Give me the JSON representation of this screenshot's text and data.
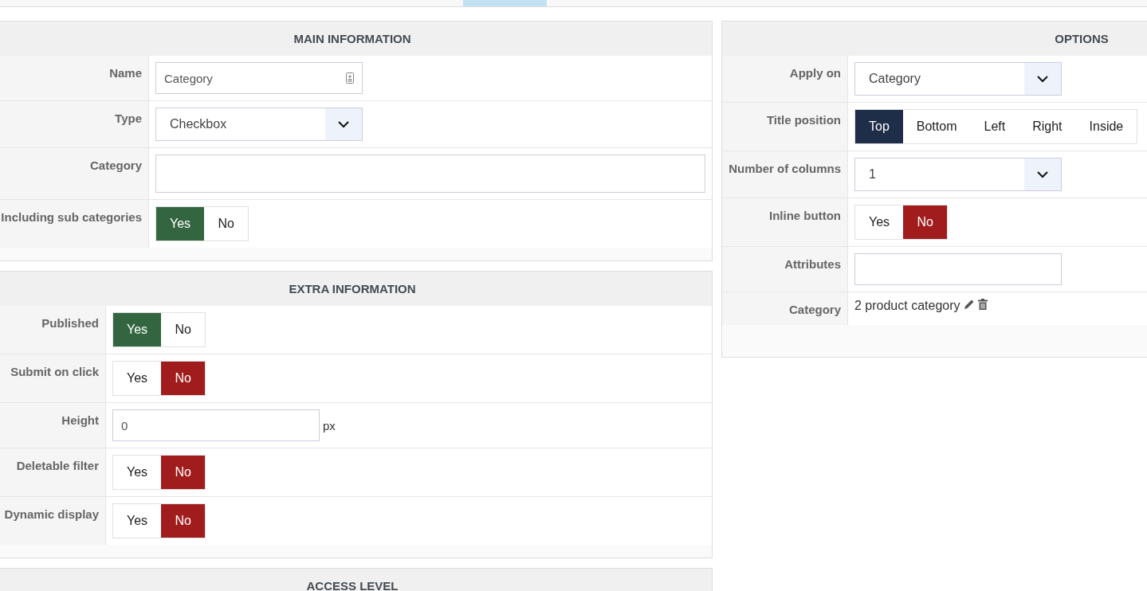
{
  "left_panels": [
    {
      "title": "MAIN INFORMATION",
      "rows": [
        {
          "kind": "text",
          "label": "Name",
          "value": "Category",
          "icon": true
        },
        {
          "kind": "select",
          "label": "Type",
          "value": "Checkbox"
        },
        {
          "kind": "wide_text",
          "label": "Category",
          "value": ""
        },
        {
          "kind": "yesno",
          "label": "Including sub categories",
          "options": [
            {
              "label": "Yes",
              "selected": true
            },
            {
              "label": "No",
              "selected": false
            }
          ]
        }
      ]
    },
    {
      "title": "EXTRA INFORMATION",
      "rows": [
        {
          "kind": "yesno",
          "label": "Published",
          "options": [
            {
              "label": "Yes",
              "selected": true
            },
            {
              "label": "No",
              "selected": false
            }
          ]
        },
        {
          "kind": "yesno",
          "label": "Submit on click",
          "options": [
            {
              "label": "Yes",
              "selected": false
            },
            {
              "label": "No",
              "selected": true
            }
          ]
        },
        {
          "kind": "text",
          "label": "Height",
          "value": "0",
          "unit": "px",
          "icon": false
        },
        {
          "kind": "yesno",
          "label": "Deletable filter",
          "options": [
            {
              "label": "Yes",
              "selected": false
            },
            {
              "label": "No",
              "selected": true
            }
          ]
        },
        {
          "kind": "yesno",
          "label": "Dynamic display",
          "options": [
            {
              "label": "Yes",
              "selected": false
            },
            {
              "label": "No",
              "selected": true
            }
          ]
        }
      ]
    },
    {
      "title": "ACCESS LEVEL"
    }
  ],
  "right_panel": {
    "title": "OPTIONS",
    "rows": [
      {
        "kind": "select",
        "label": "Apply on",
        "value": "Category"
      },
      {
        "kind": "segmented",
        "label": "Title position",
        "options": [
          {
            "label": "Top",
            "selected": true
          },
          {
            "label": "Bottom",
            "selected": false
          },
          {
            "label": "Left",
            "selected": false
          },
          {
            "label": "Right",
            "selected": false
          },
          {
            "label": "Inside",
            "selected": false
          }
        ]
      },
      {
        "kind": "select",
        "label": "Number of columns",
        "value": "1"
      },
      {
        "kind": "yesno",
        "label": "Inline button",
        "options": [
          {
            "label": "Yes",
            "selected": false
          },
          {
            "label": "No",
            "selected": true
          }
        ]
      },
      {
        "kind": "text",
        "label": "Attributes",
        "value": "",
        "icon": false
      },
      {
        "kind": "category_value",
        "label": "Category",
        "value": "2 product category"
      }
    ]
  }
}
